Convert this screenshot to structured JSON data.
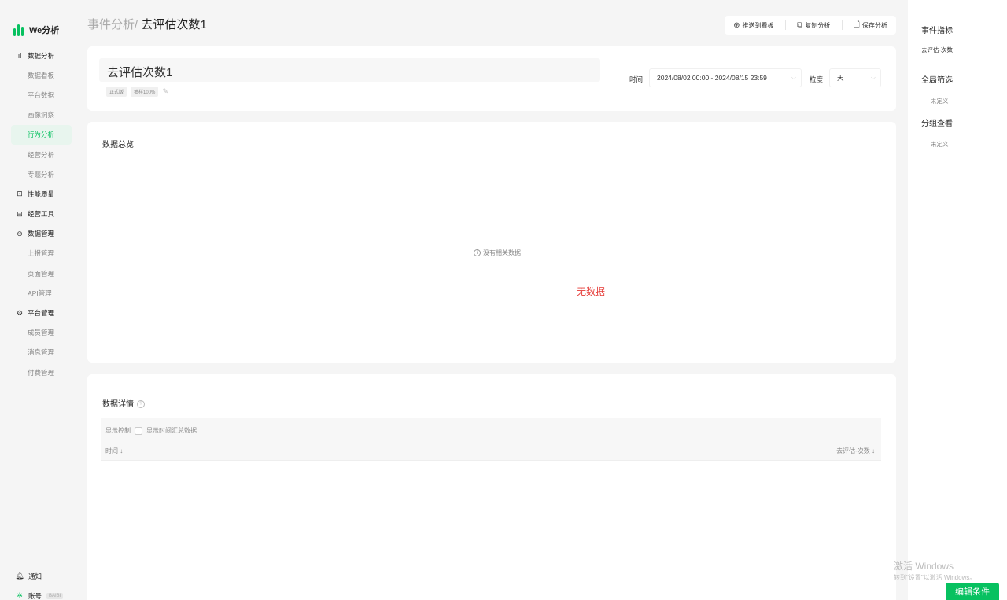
{
  "app": {
    "logo_text": "We分析"
  },
  "sidebar": {
    "items": [
      {
        "label": "数据分析",
        "type": "group",
        "icon": "bar-chart-icon"
      },
      {
        "label": "数据看板",
        "type": "sub"
      },
      {
        "label": "平台数据",
        "type": "sub"
      },
      {
        "label": "画像洞察",
        "type": "sub"
      },
      {
        "label": "行为分析",
        "type": "sub",
        "active": true
      },
      {
        "label": "经营分析",
        "type": "sub"
      },
      {
        "label": "专题分析",
        "type": "sub"
      },
      {
        "label": "性能质量",
        "type": "group",
        "icon": "monitor-icon"
      },
      {
        "label": "经营工具",
        "type": "group",
        "icon": "toolbox-icon"
      },
      {
        "label": "数据管理",
        "type": "group",
        "icon": "database-icon"
      },
      {
        "label": "上报管理",
        "type": "sub"
      },
      {
        "label": "页面管理",
        "type": "sub"
      },
      {
        "label": "API管理",
        "type": "sub"
      },
      {
        "label": "平台管理",
        "type": "group",
        "icon": "settings-icon"
      },
      {
        "label": "成员管理",
        "type": "sub"
      },
      {
        "label": "消息管理",
        "type": "sub"
      },
      {
        "label": "付费管理",
        "type": "sub"
      }
    ],
    "notify_label": "通知",
    "account_label": "账号",
    "account_tag": "BAIBI"
  },
  "header": {
    "crumb": "事件分析/",
    "title": " 去评估次数1"
  },
  "toolbar": {
    "push_label": "推送到看板",
    "copy_label": "复制分析",
    "save_label": "保存分析"
  },
  "analysis": {
    "name": "去评估次数1",
    "tags": [
      "正式版",
      "抽样100%"
    ],
    "time_label": "时间",
    "time_range": "2024/08/02 00:00 - 2024/08/15 23:59",
    "grain_label": "粒度",
    "grain_value": "天"
  },
  "overview": {
    "title": "数据总览",
    "empty_text": "没有相关数据",
    "nodata_text": "无数据"
  },
  "detail": {
    "title": "数据详情",
    "display_control_label": "显示控制",
    "show_time_summary_label": "显示时间汇总数据",
    "columns": [
      "时间 ↓",
      "去评估-次数 ↓"
    ]
  },
  "right_panel": {
    "metric_title": "事件指标",
    "metric_item": "去评估-次数",
    "filter_title": "全局筛选",
    "filter_value": "未定义",
    "group_title": "分组查看",
    "group_value": "未定义"
  },
  "watermark": {
    "line1": "激活 Windows",
    "line2": "转到\"设置\"以激活 Windows。"
  },
  "edit_condition_label": "编辑条件"
}
